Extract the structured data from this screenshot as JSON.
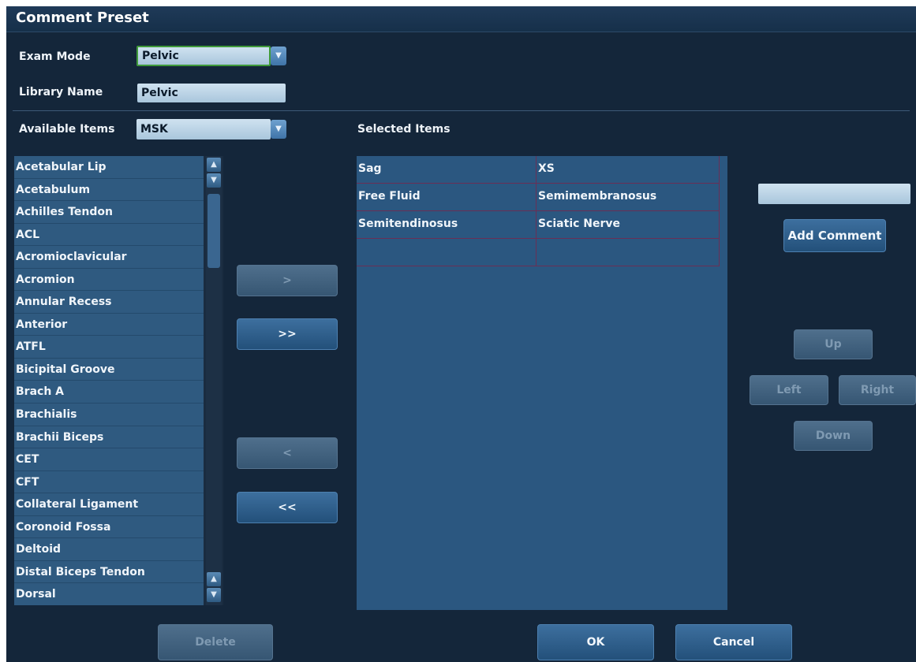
{
  "title": "Comment Preset",
  "exam_mode": {
    "label": "Exam Mode",
    "value": "Pelvic"
  },
  "library_name": {
    "label": "Library Name",
    "value": "Pelvic"
  },
  "available_items": {
    "label": "Available Items",
    "filter_value": "MSK",
    "items": [
      "Acetabular Lip",
      "Acetabulum",
      "Achilles Tendon",
      "ACL",
      "Acromioclavicular",
      "Acromion",
      "Annular Recess",
      "Anterior",
      "ATFL",
      "Bicipital Groove",
      "Brach A",
      "Brachialis",
      "Brachii Biceps",
      "CET",
      "CFT",
      "Collateral Ligament",
      "Coronoid Fossa",
      "Deltoid",
      "Distal Biceps Tendon",
      "Dorsal"
    ]
  },
  "transfer_buttons": {
    "add_one": ">",
    "add_all": ">>",
    "remove_one": "<",
    "remove_all": "<<"
  },
  "selected_items": {
    "label": "Selected Items",
    "rows": [
      [
        "Sag",
        "XS"
      ],
      [
        "Free Fluid",
        "Semimembranosus"
      ],
      [
        "Semitendinosus",
        "Sciatic Nerve"
      ],
      [
        "",
        ""
      ]
    ]
  },
  "comment_input": {
    "value": ""
  },
  "buttons": {
    "add_comment": "Add Comment",
    "up": "Up",
    "left": "Left",
    "right": "Right",
    "down": "Down",
    "delete": "Delete",
    "ok": "OK",
    "cancel": "Cancel"
  },
  "colors": {
    "background": "#14263a",
    "list_item": "#2f5a80",
    "accent_border": "#3f9a3a"
  }
}
